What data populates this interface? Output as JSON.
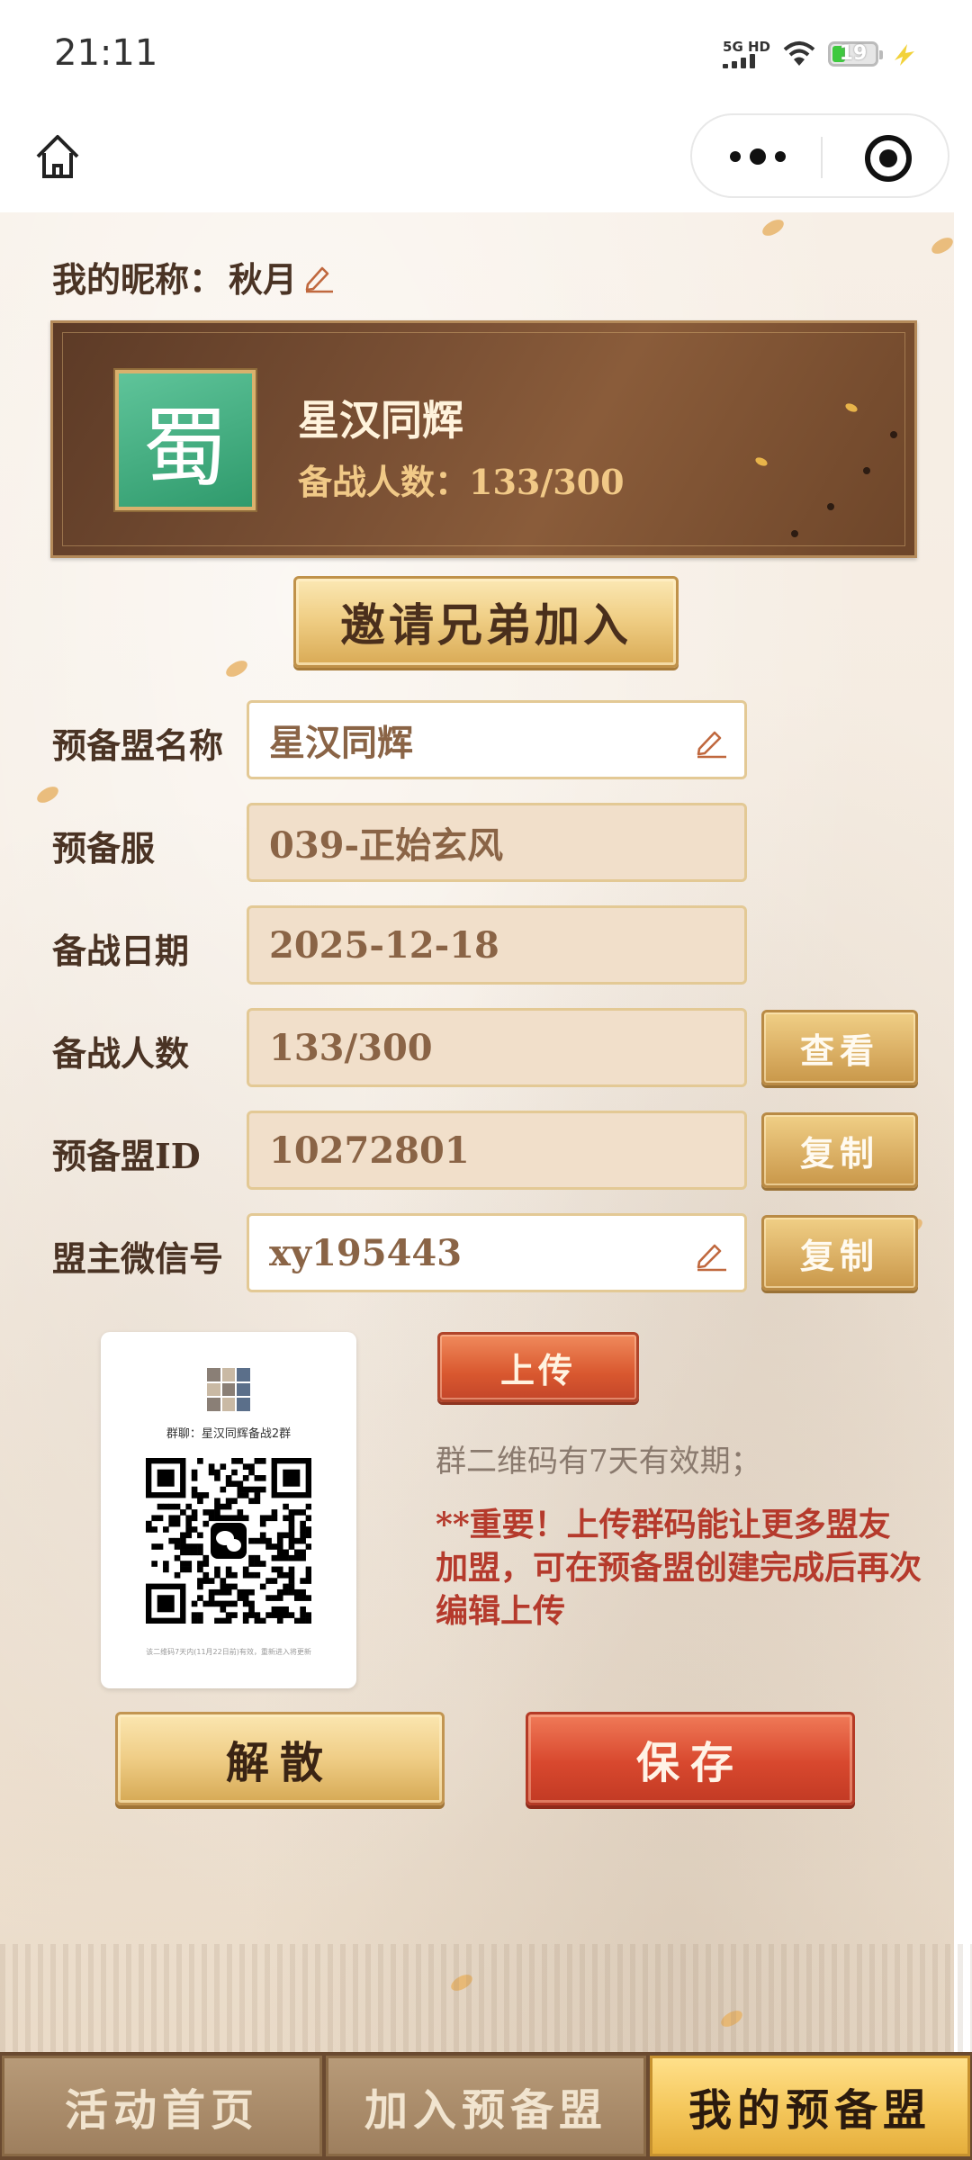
{
  "status_bar": {
    "time": "21:11",
    "network": "5G HD",
    "battery": "19",
    "battery_color": "#3ec93e"
  },
  "nav": {
    "home_icon": "home-icon",
    "more_icon": "more-dots-icon",
    "close_icon": "target-icon"
  },
  "profile": {
    "nickname_label": "我的昵称：",
    "nickname": "秋月"
  },
  "banner": {
    "emblem": "蜀",
    "alliance_name": "星汉同辉",
    "member_count": "备战人数：133/300",
    "emblem_color": "#3fae80"
  },
  "invite_button": "邀请兄弟加入",
  "form": {
    "rows": [
      {
        "label": "预备盟名称",
        "value": "星汉同辉"
      },
      {
        "label": "预备服",
        "value": "039-正始玄风"
      },
      {
        "label": "备战日期",
        "value": "2025-12-18"
      },
      {
        "label": "备战人数",
        "value": "133/300",
        "action": "查看"
      },
      {
        "label": "预备盟ID",
        "value": "10272801",
        "action": "复制"
      },
      {
        "label": "盟主微信号",
        "value": "xy195443",
        "action": "复制"
      }
    ]
  },
  "qr_card": {
    "group_title": "群聊：星汉同辉备战2群",
    "footer": "该二维码7天内(11月22日前)有效，重新进入将更新"
  },
  "upload_button": "上传",
  "qr_note": "群二维码有7天有效期；",
  "important_note": "**重要！上传群码能让更多盟友加盟，可在预备盟创建完成后再次编辑上传",
  "actions": {
    "disband": "解散",
    "save": "保存"
  },
  "tabs": [
    {
      "label": "活动首页",
      "active": false
    },
    {
      "label": "加入预备盟",
      "active": false
    },
    {
      "label": "我的预备盟",
      "active": true
    }
  ],
  "colors": {
    "gold": "#f0cf86",
    "red": "#d8482e",
    "brown": "#4a3324"
  }
}
